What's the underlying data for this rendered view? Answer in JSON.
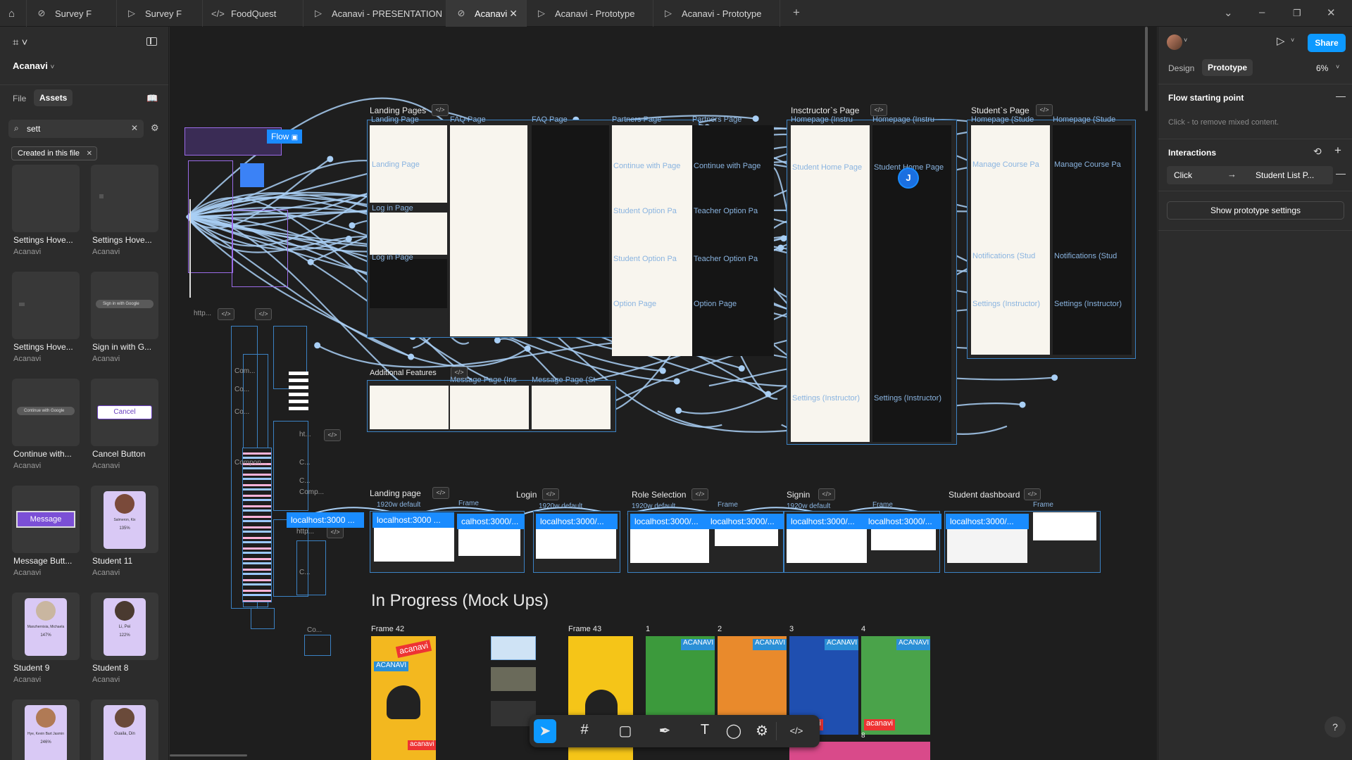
{
  "tabs": [
    {
      "label": "",
      "icon": "home-icon"
    },
    {
      "label": "Survey F",
      "icon": "figjam-icon"
    },
    {
      "label": "Survey F",
      "icon": "play-icon"
    },
    {
      "label": "FoodQuest",
      "icon": "code-icon"
    },
    {
      "label": "Acanavi - PRESENTATION",
      "icon": "play-icon"
    },
    {
      "label": "Acanavi",
      "icon": "figjam-icon"
    },
    {
      "label": "Acanavi - Prototype",
      "icon": "play-icon"
    },
    {
      "label": "Acanavi - Prototype",
      "icon": "play-icon"
    }
  ],
  "window": {
    "new_tab": "+",
    "dropdown": "⌄",
    "minimize": "–",
    "maximize": "❐",
    "close": "✕"
  },
  "left": {
    "file_name": "Acanavi",
    "tab_file": "File",
    "tab_assets": "Assets",
    "search_value": "sett",
    "filter_chip": "Created in this file",
    "assets": [
      {
        "name": "Settings Hove...",
        "source": "Acanavi"
      },
      {
        "name": "Settings Hove...",
        "source": "Acanavi"
      },
      {
        "name": "Settings Hove...",
        "source": "Acanavi"
      },
      {
        "name": "Sign in with G...",
        "source": "Acanavi",
        "preview": "Sign in with Google"
      },
      {
        "name": "Continue with...",
        "source": "Acanavi",
        "preview": "Continue with Google"
      },
      {
        "name": "Cancel Button",
        "source": "Acanavi",
        "preview": "Cancel"
      },
      {
        "name": "Message Butt...",
        "source": "Acanavi",
        "preview": "Message"
      },
      {
        "name": "Student 11",
        "source": "Acanavi",
        "preview_name": "Salmeron, Kix",
        "preview_value": "135%"
      },
      {
        "name": "Student 9",
        "source": "Acanavi",
        "preview_name": "Manzhernisia, Michaela",
        "preview_value": "147%"
      },
      {
        "name": "Student 8",
        "source": "Acanavi",
        "preview_name": "Li, Pei",
        "preview_value": "122%"
      },
      {
        "name": "",
        "source": "",
        "preview_name": "Hye, Kevin Bart Jasmin",
        "preview_value": "246%"
      },
      {
        "name": "",
        "source": "",
        "preview_name": "Guaila, Din",
        "preview_value": ""
      }
    ]
  },
  "canvas": {
    "flow_label": "Flow",
    "sections": [
      {
        "title": "Landing Pages",
        "frames": [
          "Landing Page",
          "FAQ Page",
          "FAQ Page",
          "Partners Page",
          "Partners Page"
        ]
      },
      {
        "title": "Insctructor`s Page",
        "frames": [
          "Homepage (Instru",
          "Homepage (Instru"
        ]
      },
      {
        "title": "Student`s Page",
        "frames": [
          "Homepage (Stude",
          "Homepage (Stude"
        ]
      },
      {
        "title": "Additional Features",
        "frames": [
          "Message Page (Ins",
          "Message Page (St"
        ]
      }
    ],
    "inner_labels": [
      "Landing Page",
      "Log in Page",
      "Log in Page",
      "Continue with Page",
      "Continue with Page",
      "Student Option Pa",
      "Teacher Option Pa",
      "Student Option Pa",
      "Teacher Option Pa",
      "Option Page",
      "Option Page",
      "Student Home Page",
      "Student Home Page",
      "Manage Course Pa",
      "Manage Course Pa",
      "Notifications (Stud",
      "Notifications (Stud",
      "Settings (Instructor)",
      "Settings (Instructor)",
      "Settings (Instructor)",
      "Settings (Instructor)"
    ],
    "left_group_labels": [
      "http...",
      "Com...",
      "Co...",
      "Co...",
      "Compon...",
      "ht...",
      "C...",
      "C...",
      "Comp...",
      "http...",
      "C...",
      "Co..."
    ],
    "row2": [
      {
        "title": "Landing page",
        "sub1": "1920w default",
        "sub2": "Frame",
        "links": [
          "localhost:3000 ...",
          "localhost:3000 ...",
          "calhost:3000/..."
        ]
      },
      {
        "title": "Login",
        "sub1": "1920w default",
        "sub2": "",
        "links": [
          "localhost:3000/..."
        ]
      },
      {
        "title": "Role Selection",
        "sub1": "1920w default",
        "sub2": "Frame",
        "links": [
          "localhost:3000/...",
          "localhost:3000/..."
        ]
      },
      {
        "title": "Signin",
        "sub1": "1920w default",
        "sub2": "Frame",
        "links": [
          "localhost:3000/...",
          "localhost:3000/..."
        ]
      },
      {
        "title": "Student dashboard",
        "sub1": "1920w default",
        "sub2": "Frame",
        "links": [
          "localhost:3000/..."
        ]
      }
    ],
    "first_link": "localhost:3000 ...",
    "in_progress_title": "In Progress (Mock Ups)",
    "mockups": [
      "Frame 42",
      "Frame 43",
      "1",
      "2",
      "3",
      "4",
      "8"
    ],
    "poster_words": [
      "ACANAVI",
      "acanavi"
    ],
    "comment_avatar": "J"
  },
  "toolbar": [
    {
      "name": "move-tool",
      "glyph": "➤"
    },
    {
      "name": "frame-tool",
      "glyph": "#"
    },
    {
      "name": "shape-tool",
      "glyph": "▢"
    },
    {
      "name": "pen-tool",
      "glyph": "✒"
    },
    {
      "name": "text-tool",
      "glyph": "T"
    },
    {
      "name": "comment-tool",
      "glyph": "◯"
    },
    {
      "name": "actions-tool",
      "glyph": "⚙"
    },
    {
      "name": "dev-mode-toggle",
      "glyph": "</>"
    }
  ],
  "right": {
    "tab_design": "Design",
    "tab_prototype": "Prototype",
    "zoom": "6%",
    "share": "Share",
    "flow_start_title": "Flow starting point",
    "flow_start_hint": "Click - to remove mixed content.",
    "interactions_title": "Interactions",
    "interaction_trigger": "Click",
    "interaction_target": "Student List P...",
    "show_settings": "Show prototype settings"
  },
  "help": "?",
  "colors": {
    "accent": "#0d99ff",
    "link": "#8fc3f5",
    "panel": "#2c2c2c",
    "canvas": "#1e1e1e"
  }
}
